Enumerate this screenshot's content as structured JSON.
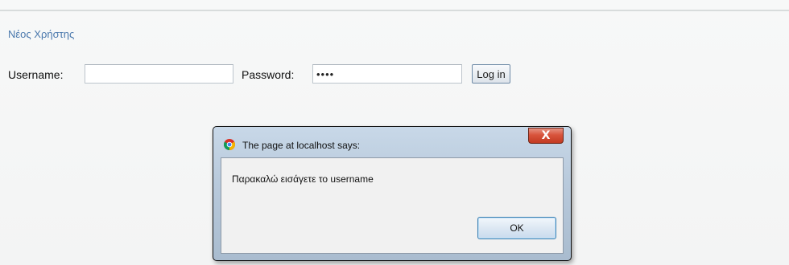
{
  "page": {
    "new_user_link": "Νέος Χρήστης"
  },
  "login": {
    "username_label": "Username:",
    "username_value": "",
    "password_label": "Password:",
    "password_value": "••••",
    "login_button": "Log in"
  },
  "dialog": {
    "title": "The page at localhost says:",
    "message": "Παρακαλώ εισάγετε το username",
    "ok_button": "OK",
    "close_glyph": "X",
    "icon": "chrome-icon"
  },
  "colors": {
    "link": "#4a79ad",
    "close_button": "#d8543c",
    "dialog_frame": "#b9cadc"
  }
}
